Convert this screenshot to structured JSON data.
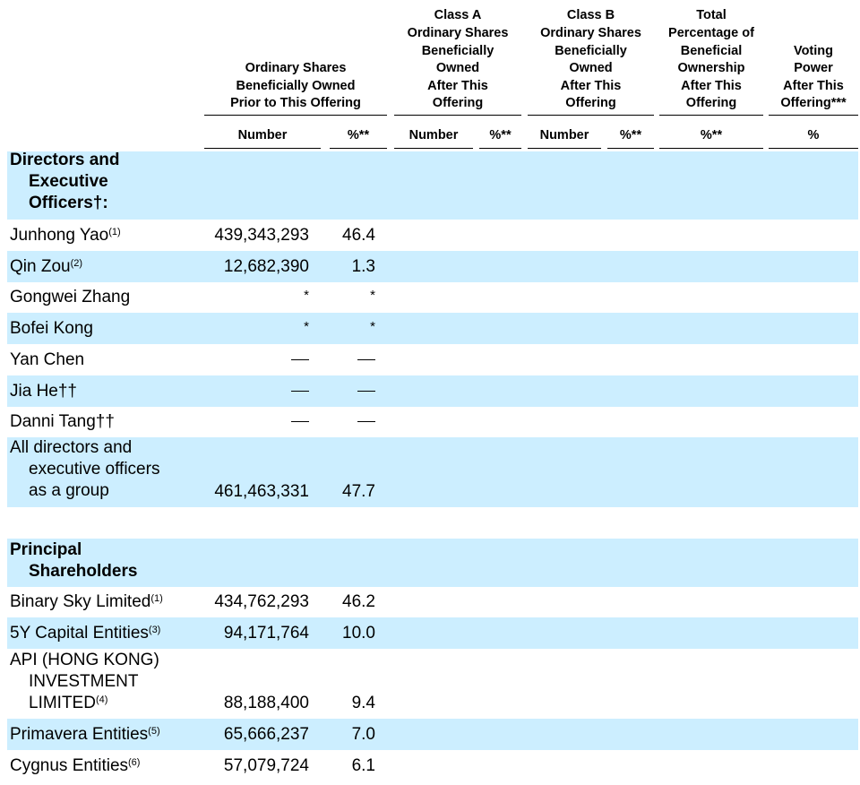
{
  "headers": {
    "prior": "Ordinary Shares\nBeneficially Owned\nPrior to This Offering",
    "class_a": "Class A\nOrdinary Shares\nBeneficially\nOwned\nAfter This\nOffering",
    "class_b": "Class B\nOrdinary Shares\nBeneficially\nOwned\nAfter This\nOffering",
    "total": "Total\nPercentage of\nBeneficial\nOwnership\nAfter This\nOffering",
    "voting": "Voting\nPower\nAfter This\nOffering***"
  },
  "subheaders": {
    "prior_number": "Number",
    "prior_pct": "%**",
    "a_number": "Number",
    "a_pct": "%**",
    "b_number": "Number",
    "b_pct": "%**",
    "total_pct": "%**",
    "voting_pct": "%"
  },
  "sections": {
    "directors": "Directors and\nExecutive\nOfficers†:",
    "principal": "Principal\nShareholders"
  },
  "directors": [
    {
      "name": "Junhong Yao",
      "note": "(1)",
      "number": "439,343,293",
      "pct": "46.4"
    },
    {
      "name": "Qin Zou",
      "note": "(2)",
      "number": "12,682,390",
      "pct": "1.3"
    },
    {
      "name": "Gongwei Zhang",
      "note": "",
      "number": "*",
      "pct": "*"
    },
    {
      "name": "Bofei Kong",
      "note": "",
      "number": "*",
      "pct": "*"
    },
    {
      "name": "Yan Chen",
      "note": "",
      "number": "—",
      "pct": "—"
    },
    {
      "name": "Jia He††",
      "note": "",
      "number": "—",
      "pct": "—"
    },
    {
      "name": "Danni Tang††",
      "note": "",
      "number": "—",
      "pct": "—"
    }
  ],
  "group": {
    "name": "All directors and\nexecutive officers\nas a group",
    "number": "461,463,331",
    "pct": "47.7"
  },
  "principal": [
    {
      "name": "Binary Sky Limited",
      "note": "(1)",
      "number": "434,762,293",
      "pct": "46.2"
    },
    {
      "name": "5Y Capital Entities",
      "note": "(3)",
      "number": "94,171,764",
      "pct": "10.0"
    },
    {
      "name": "API (HONG KONG)\nINVESTMENT\nLIMITED",
      "note": "(4)",
      "number": "88,188,400",
      "pct": "9.4"
    },
    {
      "name": "Primavera Entities",
      "note": "(5)",
      "number": "65,666,237",
      "pct": "7.0"
    },
    {
      "name": "Cygnus Entities",
      "note": "(6)",
      "number": "57,079,724",
      "pct": "6.1"
    }
  ]
}
